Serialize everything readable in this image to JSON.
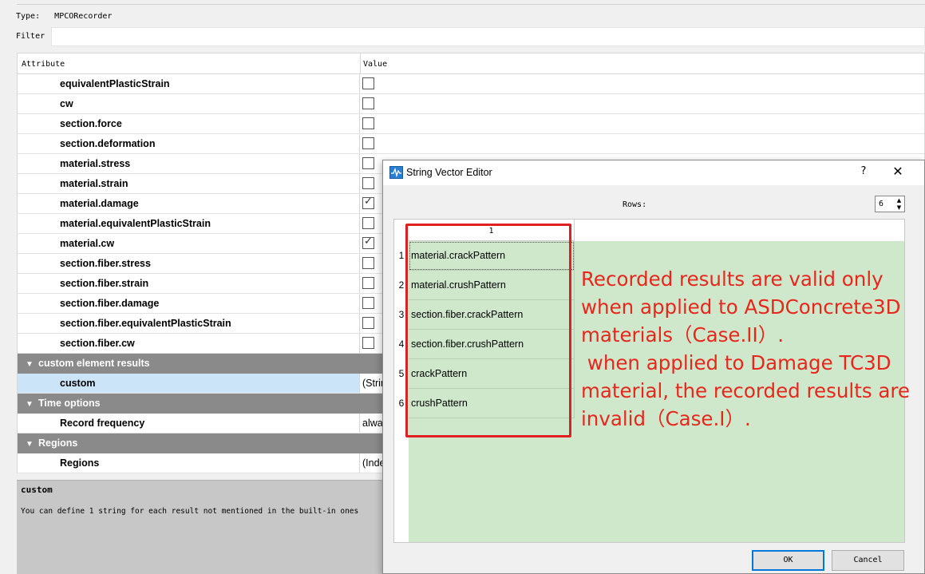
{
  "header": {
    "type_label": "Type:",
    "type_value": "MPCORecorder",
    "filter_label": "Filter",
    "filter_value": ""
  },
  "grid": {
    "col_attribute": "Attribute",
    "col_value": "Value",
    "rows": [
      {
        "name": "equivalentPlasticStrain",
        "checked": false
      },
      {
        "name": "cw",
        "checked": false
      },
      {
        "name": "section.force",
        "checked": false
      },
      {
        "name": "section.deformation",
        "checked": false
      },
      {
        "name": "material.stress",
        "checked": false
      },
      {
        "name": "material.strain",
        "checked": false
      },
      {
        "name": "material.damage",
        "checked": true
      },
      {
        "name": "material.equivalentPlasticStrain",
        "checked": false
      },
      {
        "name": "material.cw",
        "checked": true
      },
      {
        "name": "section.fiber.stress",
        "checked": false
      },
      {
        "name": "section.fiber.strain",
        "checked": false
      },
      {
        "name": "section.fiber.damage",
        "checked": false
      },
      {
        "name": "section.fiber.equivalentPlasticStrain",
        "checked": false
      },
      {
        "name": "section.fiber.cw",
        "checked": false
      }
    ],
    "section_custom": "custom element results",
    "custom_name": "custom",
    "custom_value": "(Strin",
    "section_time": "Time options",
    "record_frequency_name": "Record frequency",
    "record_frequency_value": "alwa",
    "section_regions": "Regions",
    "regions_name": "Regions",
    "regions_value": "(Inde"
  },
  "description": {
    "title": "custom",
    "text": "You can define 1 string for each result not mentioned in the built-in ones"
  },
  "dialog": {
    "title": "String Vector Editor",
    "help": "?",
    "close": "✕",
    "rows_label": "Rows:",
    "rows_value": "6",
    "column_header": "1",
    "row_numbers": [
      "1",
      "2",
      "3",
      "4",
      "5",
      "6"
    ],
    "cells": [
      "material.crackPattern",
      "material.crushPattern",
      "section.fiber.crackPattern",
      "section.fiber.crushPattern",
      "crackPattern",
      "crushPattern"
    ],
    "ok_label": "OK",
    "cancel_label": "Cancel"
  },
  "annotation": {
    "text": "Recorded results are valid only\nwhen applied to ASDConcrete3D\nmaterials（Case.II）.\n when applied to Damage TC3D\nmaterial, the recorded results are\ninvalid（Case.I）.",
    "color": "#e8271c"
  }
}
